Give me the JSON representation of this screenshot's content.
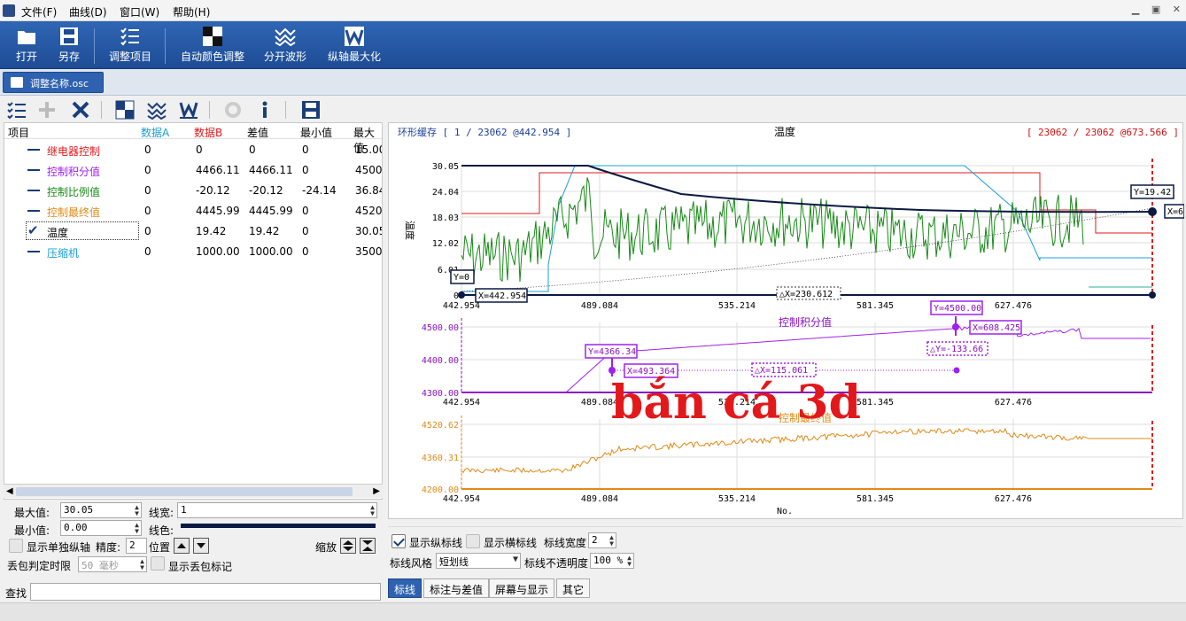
{
  "menu": {
    "file": "文件(F)",
    "curve": "曲线(D)",
    "window": "窗口(W)",
    "help": "帮助(H)"
  },
  "ribbon": {
    "open": "打开",
    "save_as": "另存",
    "adjust_items": "调整项目",
    "auto_color": "自动颜色调整",
    "split_wave": "分开波形",
    "max_y": "纵轴最大化"
  },
  "doc_tab": "调整名称.osc",
  "table": {
    "headers": [
      "项目",
      "数据A",
      "数据B",
      "差值",
      "最小值",
      "最大值"
    ],
    "rows": [
      {
        "name": "继电器控制",
        "a": "0",
        "b": "0",
        "diff": "0",
        "min": "0",
        "max": "15.00",
        "color": "#e0191b"
      },
      {
        "name": "控制积分值",
        "a": "0",
        "b": "4466.11",
        "diff": "4466.11",
        "min": "0",
        "max": "4500.",
        "color": "#a020f0"
      },
      {
        "name": "控制比例值",
        "a": "0",
        "b": "-20.12",
        "diff": "-20.12",
        "min": "-24.14",
        "max": "36.84",
        "color": "#168a16"
      },
      {
        "name": "控制最终值",
        "a": "0",
        "b": "4445.99",
        "diff": "4445.99",
        "min": "0",
        "max": "4520.",
        "color": "#e08a16"
      },
      {
        "name": "温度",
        "a": "0",
        "b": "19.42",
        "diff": "19.42",
        "min": "0",
        "max": "30.05",
        "color": "#000000"
      },
      {
        "name": "压缩机",
        "a": "0",
        "b": "1000.00",
        "diff": "1000.00",
        "min": "0",
        "max": "3500.",
        "color": "#1aa0d8"
      }
    ]
  },
  "props": {
    "max_label": "最大值:",
    "max_value": "30.05",
    "min_label": "最小值:",
    "min_value": "0.00",
    "linewidth_label": "线宽:",
    "linewidth_value": "1",
    "linecolor_label": "线色:",
    "single_axis_label": "显示单独纵轴",
    "precision_label": "精度:",
    "precision_value": "2",
    "position_label": "位置",
    "zoom_label": "缩放",
    "loss_label": "丢包判定时限",
    "loss_value": "50 毫秒",
    "show_loss_label": "显示丢包标记",
    "find_label": "查找"
  },
  "chart_header": {
    "left": "环形缓存 [ 1 / 23062 @442.954 ]",
    "title": "温度",
    "right": "[ 23062 / 23062 @673.566 ]"
  },
  "chart_data": [
    {
      "type": "line",
      "title": "温度",
      "ylabel": "温度",
      "ylim": [
        0,
        30.05
      ],
      "y_ticks": [
        "30.05",
        "24.04",
        "18.03",
        "12.02",
        "6.01",
        "0"
      ],
      "x_ticks": [
        "442.954",
        "489.084",
        "535.214",
        "581.345",
        "627.476"
      ],
      "markers": {
        "y0": "Y=0",
        "x0": "X=442.954",
        "dx": "△X=230.612",
        "y1": "Y=19.42",
        "x1": "X=6"
      }
    },
    {
      "type": "line",
      "title": "控制积分值",
      "ylim": [
        4300,
        4500
      ],
      "y_ticks": [
        "4500.00",
        "4400.00",
        "4300.00"
      ],
      "x_ticks": [
        "442.954",
        "489.084",
        "535.214",
        "581.345",
        "627.476"
      ],
      "markers": {
        "ya": "Y=4366.34",
        "xa": "X=493.364",
        "dx": "△X=115.061",
        "yb": "Y=4500.00",
        "xb": "X=608.425",
        "dy": "△Y=-133.66"
      }
    },
    {
      "type": "line",
      "title": "控制最终值",
      "ylim": [
        4200,
        4520.62
      ],
      "y_ticks": [
        "4520.62",
        "4360.31",
        "4200.00"
      ],
      "x_ticks": [
        "442.954",
        "489.084",
        "535.214",
        "581.345",
        "627.476"
      ],
      "xlabel": "No."
    }
  ],
  "bottom": {
    "show_vline": "显示纵标线",
    "show_hline": "显示横标线",
    "linewidth_label": "标线宽度",
    "linewidth_value": "2",
    "style_label": "标线风格",
    "style_value": "短划线",
    "opacity_label": "标线不透明度",
    "opacity_value": "100 %",
    "tabs": [
      "标线",
      "标注与差值",
      "屏幕与显示",
      "其它"
    ]
  },
  "watermark": "bắn cá 3d"
}
